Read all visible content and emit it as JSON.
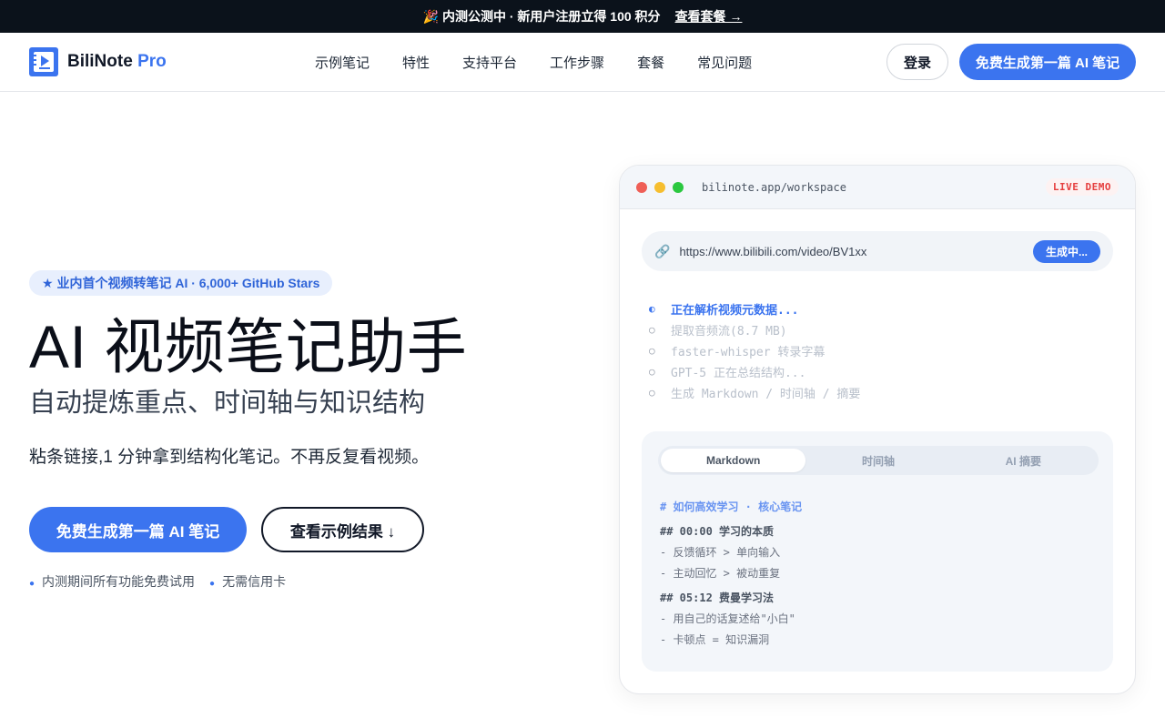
{
  "promo": {
    "text": "内测公测中 · 新用户注册立得 100 积分",
    "link": "查看套餐 →"
  },
  "nav": {
    "brand": "BiliNote",
    "brand_suffix": "Pro",
    "links": [
      "示例笔记",
      "特性",
      "支持平台",
      "工作步骤",
      "套餐",
      "常见问题"
    ],
    "login": "登录",
    "cta": "免费生成第一篇 AI 笔记"
  },
  "hero": {
    "badge": "★ 业内首个视频转笔记 AI · 6,000+ GitHub Stars",
    "title": "AI 视频笔记助手",
    "subtitle": "自动提炼重点、时间轴与知识结构",
    "description": "粘条链接,1 分钟拿到结构化笔记。不再反复看视频。",
    "primary_button": "免费生成第一篇 AI 笔记",
    "secondary_button": "查看示例结果 ↓",
    "notes": [
      "内测期间所有功能免费试用",
      "无需信用卡"
    ]
  },
  "demo": {
    "url": "bilinote.app/workspace",
    "live_label": "LIVE DEMO",
    "input_value": "https://www.bilibili.com/video/BV1xx",
    "generate_button": "生成中...",
    "steps": [
      {
        "icon": "◐",
        "text": "正在解析视频元数据...",
        "active": true
      },
      {
        "icon": "○",
        "text": "提取音频流(8.7 MB)",
        "active": false
      },
      {
        "icon": "○",
        "text": "faster-whisper 转录字幕",
        "active": false
      },
      {
        "icon": "○",
        "text": "GPT-5 正在总结结构...",
        "active": false
      },
      {
        "icon": "○",
        "text": "生成 Markdown / 时间轴 / 摘要",
        "active": false
      }
    ],
    "tabs": [
      "Markdown",
      "时间轴",
      "AI 摘要"
    ],
    "markdown": {
      "title": "# 如何高效学习 · 核心笔记",
      "section1": "## 00:00 学习的本质",
      "s1_items": [
        "- 反馈循环 > 单向输入",
        "- 主动回忆 > 被动重复"
      ],
      "section2": "## 05:12 费曼学习法",
      "s2_items": [
        "- 用自己的话复述给\"小白\"",
        "- 卡顿点 = 知识漏洞"
      ]
    }
  }
}
